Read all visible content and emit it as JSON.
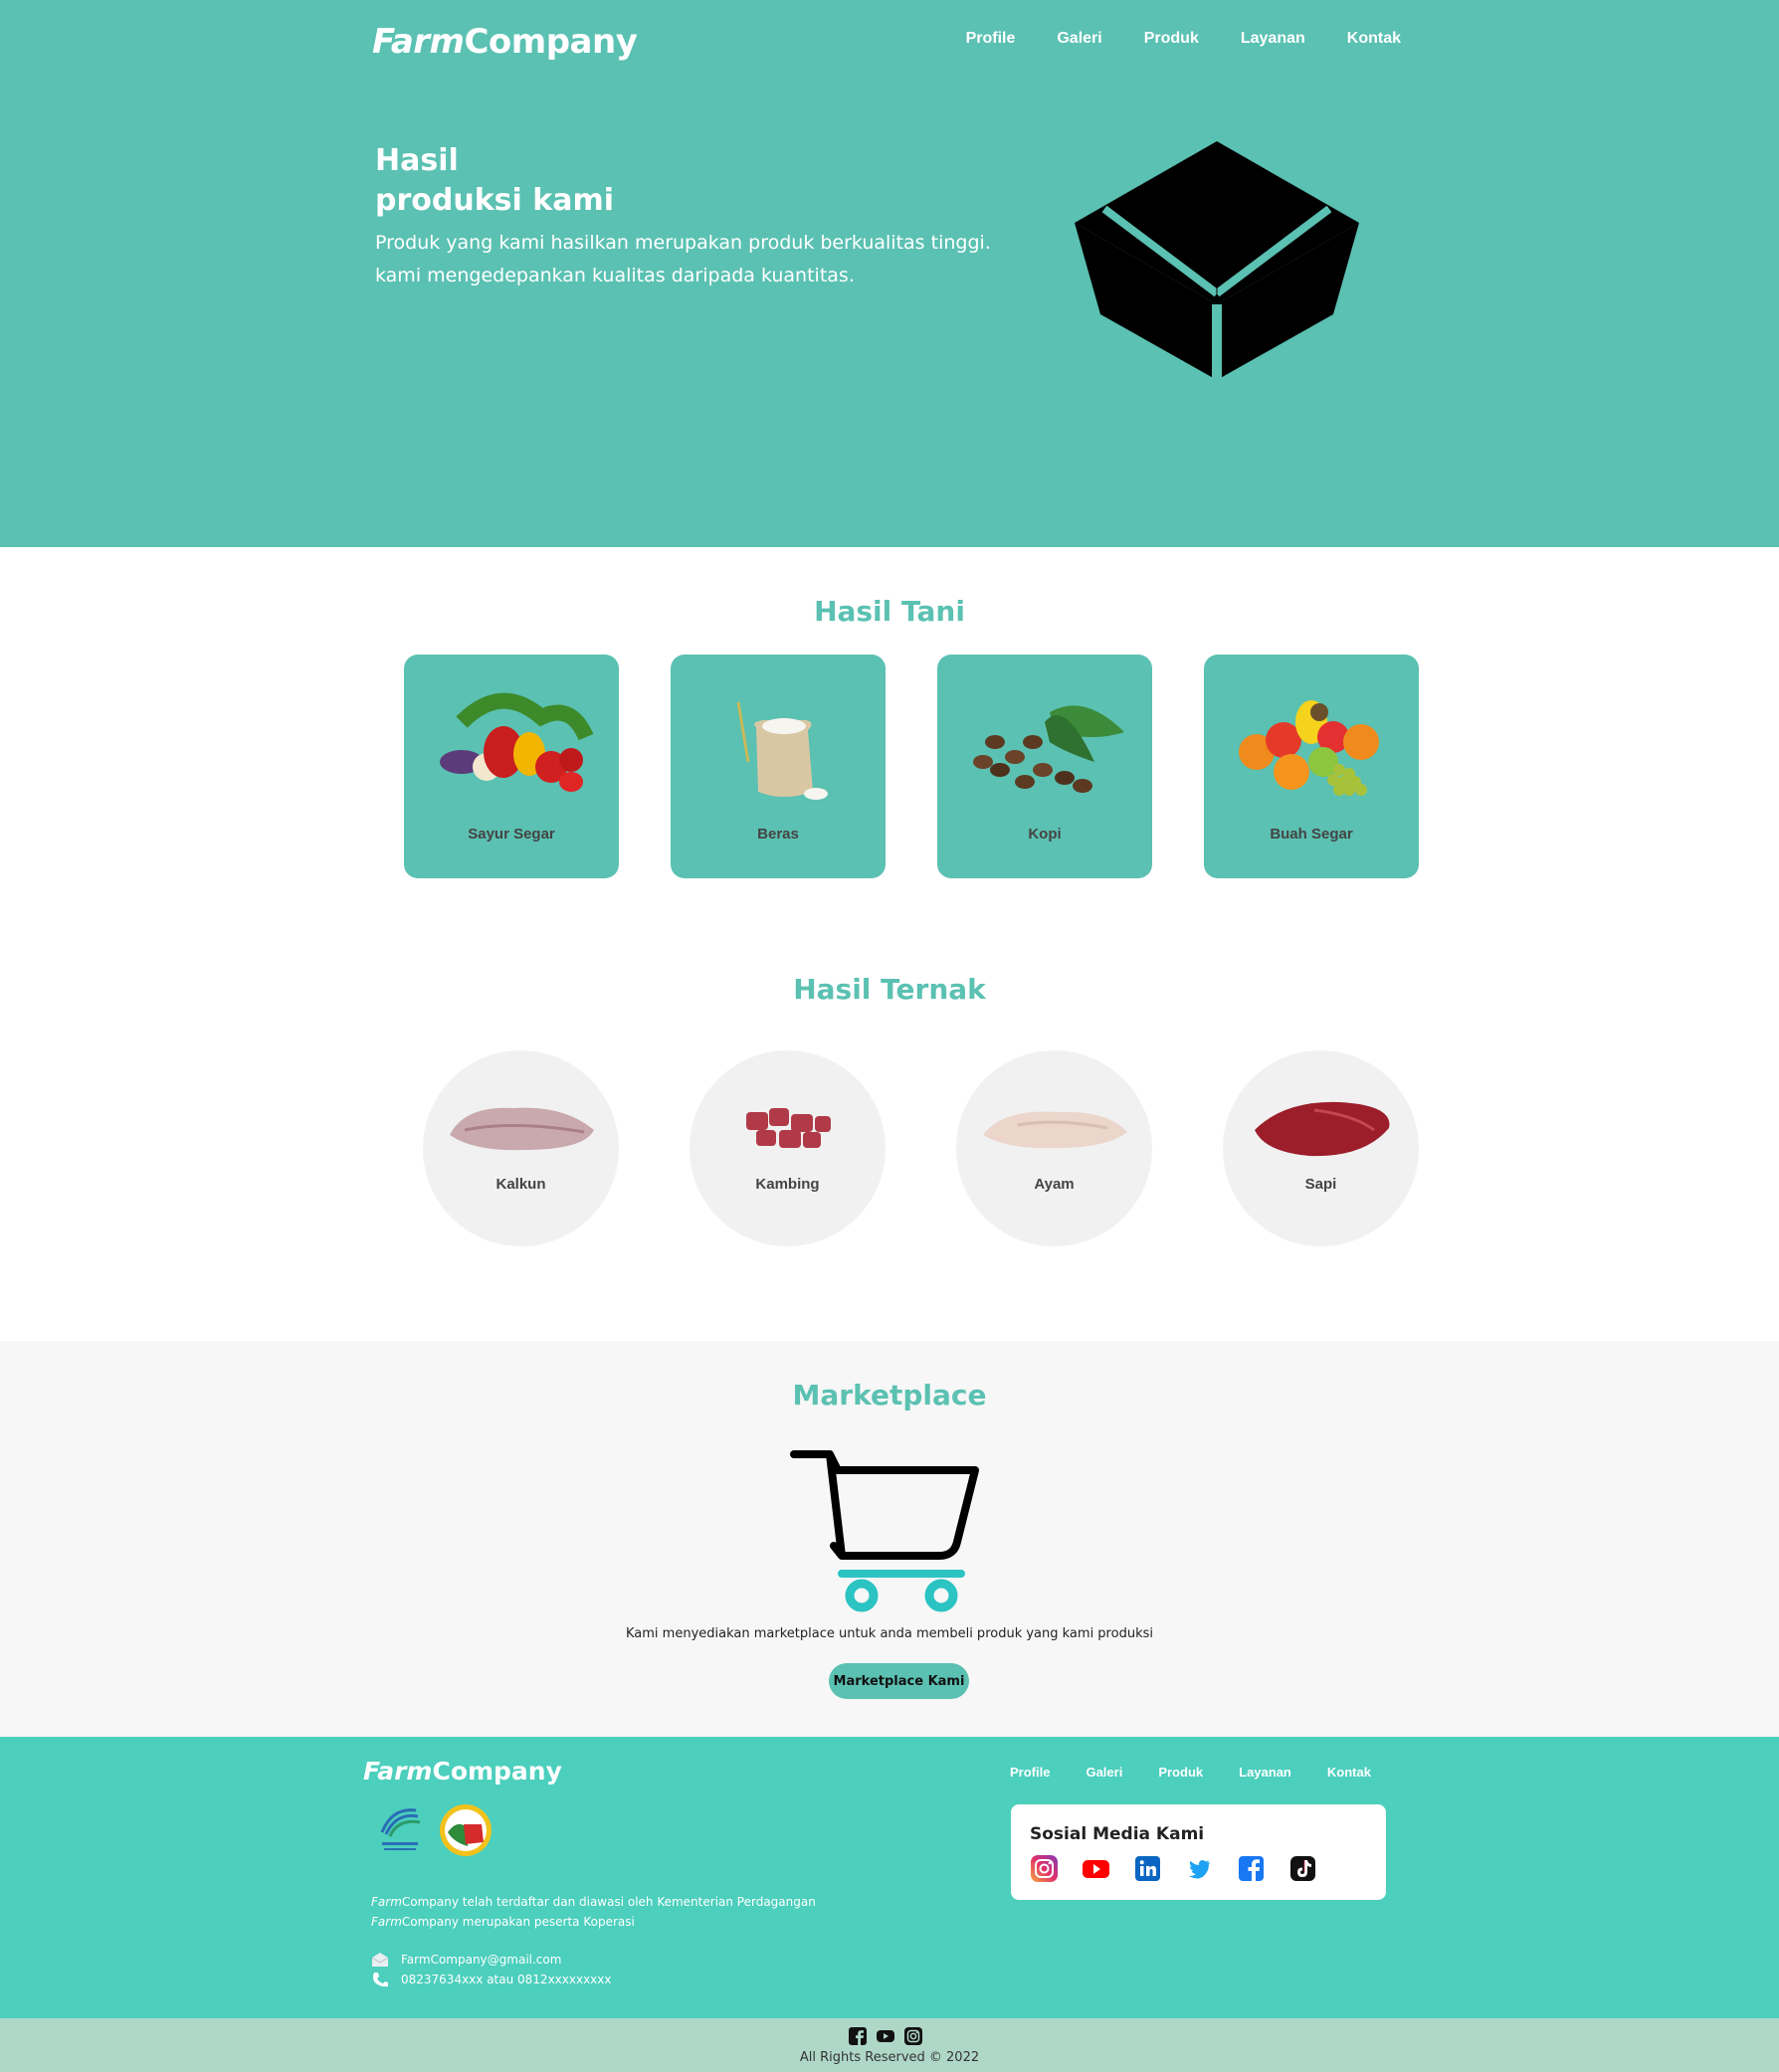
{
  "brand": {
    "farm": "Farm",
    "company": "Company"
  },
  "nav": {
    "items": [
      "Profile",
      "Galeri",
      "Produk",
      "Layanan",
      "Kontak"
    ]
  },
  "hero": {
    "title_line1": "Hasil",
    "title_line2": "produksi kami",
    "desc_line1": "Produk yang kami hasilkan merupakan produk berkualitas tinggi.",
    "desc_line2": "kami mengedepankan kualitas daripada kuantitas.",
    "icon": "box-icon"
  },
  "tani": {
    "title": "Hasil Tani",
    "items": [
      {
        "label": "Sayur Segar",
        "icon": "vegetables-image"
      },
      {
        "label": "Beras",
        "icon": "rice-sack-image"
      },
      {
        "label": "Kopi",
        "icon": "coffee-beans-image"
      },
      {
        "label": "Buah Segar",
        "icon": "fruits-image"
      }
    ]
  },
  "ternak": {
    "title": "Hasil Ternak",
    "items": [
      {
        "label": "Kalkun",
        "icon": "turkey-meat-image"
      },
      {
        "label": "Kambing",
        "icon": "goat-meat-image"
      },
      {
        "label": "Ayam",
        "icon": "chicken-meat-image"
      },
      {
        "label": "Sapi",
        "icon": "beef-image"
      }
    ]
  },
  "marketplace": {
    "title": "Marketplace",
    "desc": "Kami menyediakan marketplace untuk anda membeli produk yang kami produksi",
    "button": "Marketplace Kami",
    "icon": "shopping-cart-icon"
  },
  "footer": {
    "legal_line1_rest": " telah terdaftar dan diawasi oleh Kementerian Perdagangan",
    "legal_line2_rest": " merupakan peserta Koperasi",
    "email": "FarmCompany@gmail.com",
    "phone": "08237634xxx atau 0812xxxxxxxxx",
    "social_title": "Sosial Media Kami",
    "social_icons": [
      "instagram-icon",
      "youtube-icon",
      "linkedin-icon",
      "twitter-icon",
      "facebook-icon",
      "tiktok-icon"
    ],
    "bottom_icons": [
      "facebook-icon",
      "youtube-icon",
      "instagram-icon"
    ],
    "copyright": "All Rights Reserved © 2022"
  },
  "colors": {
    "primary": "#5bc1b2",
    "footer": "#4ccfbd",
    "bottom_bar": "#afd7c8",
    "light_gray": "#f1f1f1"
  }
}
